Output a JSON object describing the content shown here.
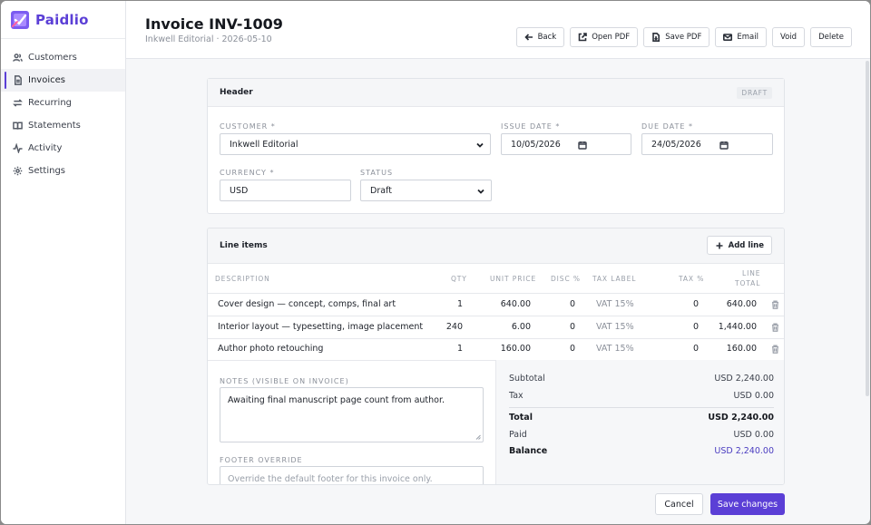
{
  "brand": {
    "name": "Paidlio"
  },
  "nav": [
    {
      "label": "Customers",
      "icon": "users-icon",
      "active": false
    },
    {
      "label": "Invoices",
      "icon": "document-icon",
      "active": true
    },
    {
      "label": "Recurring",
      "icon": "repeat-icon",
      "active": false
    },
    {
      "label": "Statements",
      "icon": "book-icon",
      "active": false
    },
    {
      "label": "Activity",
      "icon": "activity-icon",
      "active": false
    },
    {
      "label": "Settings",
      "icon": "gear-icon",
      "active": false
    }
  ],
  "header": {
    "title": "Invoice INV-1009",
    "subtitle": "Inkwell Editorial · 2026-05-10",
    "actions": {
      "back": "Back",
      "open_pdf": "Open PDF",
      "save_pdf": "Save PDF",
      "email": "Email",
      "void": "Void",
      "delete": "Delete"
    }
  },
  "header_card": {
    "title": "Header",
    "badge": "DRAFT",
    "customer_label": "CUSTOMER *",
    "customer_value": "Inkwell Editorial",
    "issue_label": "ISSUE DATE *",
    "issue_value": "10/05/2026",
    "due_label": "DUE DATE *",
    "due_value": "24/05/2026",
    "currency_label": "CURRENCY *",
    "currency_value": "USD",
    "status_label": "STATUS",
    "status_value": "Draft"
  },
  "line_items": {
    "title": "Line items",
    "add_label": "Add line",
    "columns": {
      "description": "DESCRIPTION",
      "qty": "QTY",
      "unit_price": "UNIT PRICE",
      "disc": "DISC %",
      "tax_label": "TAX LABEL",
      "tax": "TAX %",
      "line_total_1": "LINE",
      "line_total_2": "TOTAL"
    },
    "rows": [
      {
        "description": "Cover design — concept, comps, final art",
        "qty": "1",
        "unit_price": "640.00",
        "disc": "0",
        "tax_label": "VAT 15%",
        "tax": "0",
        "total": "640.00"
      },
      {
        "description": "Interior layout — typesetting, image placement",
        "qty": "240",
        "unit_price": "6.00",
        "disc": "0",
        "tax_label": "VAT 15%",
        "tax": "0",
        "total": "1,440.00"
      },
      {
        "description": "Author photo retouching",
        "qty": "1",
        "unit_price": "160.00",
        "disc": "0",
        "tax_label": "VAT 15%",
        "tax": "0",
        "total": "160.00"
      }
    ]
  },
  "notes": {
    "label": "NOTES (VISIBLE ON INVOICE)",
    "value": "Awaiting final manuscript page count from author.",
    "footer_label": "FOOTER OVERRIDE",
    "footer_placeholder": "Override the default footer for this invoice only."
  },
  "totals": {
    "subtotal_label": "Subtotal",
    "subtotal": "USD 2,240.00",
    "tax_label": "Tax",
    "tax": "USD 0.00",
    "total_label": "Total",
    "total": "USD 2,240.00",
    "paid_label": "Paid",
    "paid": "USD 0.00",
    "balance_label": "Balance",
    "balance": "USD 2,240.00"
  },
  "footer_actions": {
    "cancel": "Cancel",
    "save": "Save changes"
  },
  "colors": {
    "accent": "#5b3fd6",
    "balance": "#4a3cc0"
  }
}
